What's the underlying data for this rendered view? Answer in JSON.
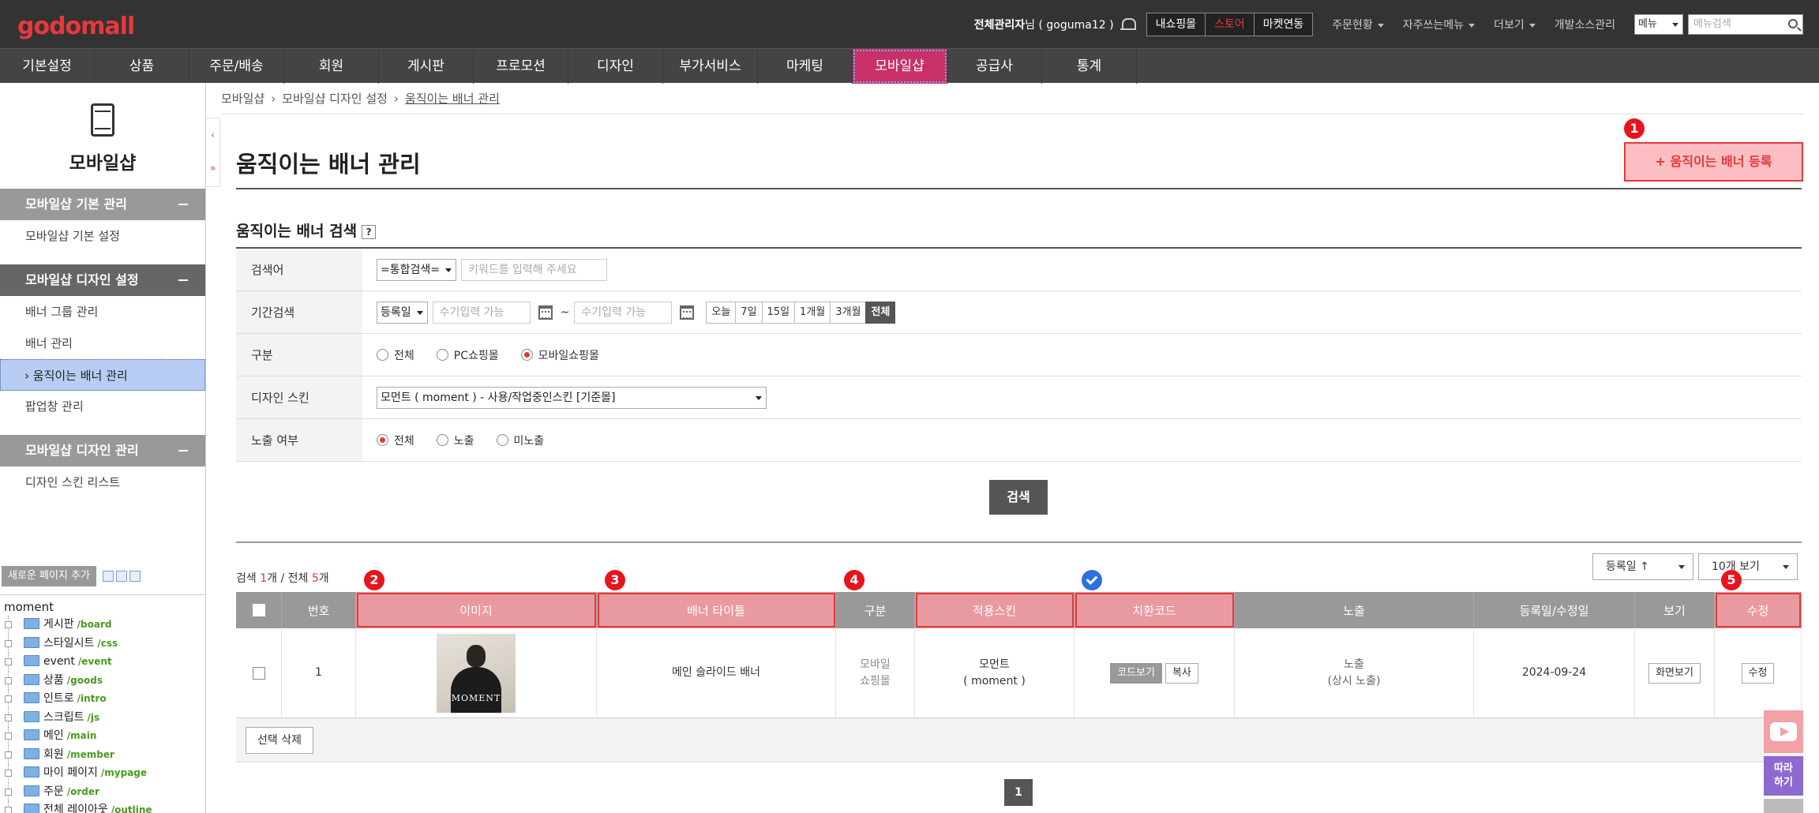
{
  "header": {
    "logo": "godomall",
    "admin_role": "전체관리자",
    "admin_suffix": "님 ( goguma12 )",
    "buttons": [
      "내쇼핑몰",
      "스토어",
      "마켓연동"
    ],
    "links": [
      "주문현황",
      "자주쓰는메뉴",
      "더보기",
      "개발소스관리"
    ],
    "menu_select": "메뉴",
    "menu_search_placeholder": "메뉴검색"
  },
  "gnb": [
    "기본설정",
    "상품",
    "주문/배송",
    "회원",
    "게시판",
    "프로모션",
    "디자인",
    "부가서비스",
    "마케팅",
    "모바일샵",
    "공급사",
    "통계"
  ],
  "lnb": {
    "title": "모바일샵",
    "groups": [
      {
        "title": "모바일샵 기본 관리",
        "items": [
          "모바일샵 기본 설정"
        ]
      },
      {
        "title": "모바일샵 디자인 설정",
        "items": [
          "배너 그룹 관리",
          "배너 관리",
          "움직이는 배너 관리",
          "팝업창 관리"
        ]
      },
      {
        "title": "모바일샵 디자인 관리",
        "items": [
          "디자인 스킨 리스트"
        ]
      }
    ],
    "active_item_prefix": "›",
    "add_page": "새로운 페이지 추가",
    "tree_root": "moment",
    "tree": [
      {
        "name": "게시판",
        "path": "/board"
      },
      {
        "name": "스타일시트",
        "path": "/css"
      },
      {
        "name": "event",
        "path": "/event"
      },
      {
        "name": "상품",
        "path": "/goods"
      },
      {
        "name": "인트로",
        "path": "/intro"
      },
      {
        "name": "스크립트",
        "path": "/js"
      },
      {
        "name": "메인",
        "path": "/main"
      },
      {
        "name": "회원",
        "path": "/member"
      },
      {
        "name": "마이 페이지",
        "path": "/mypage"
      },
      {
        "name": "주문",
        "path": "/order"
      },
      {
        "name": "전체 레이아웃",
        "path": "/outline"
      }
    ]
  },
  "breadcrumb": [
    "모바일샵",
    "모바일샵 디자인 설정",
    "움직이는 배너 관리"
  ],
  "page": {
    "title": "움직이는 배너 관리",
    "register_button": "+ 움직이는 배너 등록",
    "search_section_title": "움직이는 배너 검색",
    "help": "?"
  },
  "search": {
    "keyword_label": "검색어",
    "keyword_select": "=통합검색=",
    "keyword_placeholder": "키워드를 입력해 주세요",
    "period_label": "기간검색",
    "period_select": "등록일",
    "date_placeholder": "수기입력 가능",
    "tilde": "~",
    "period_buttons": [
      "오늘",
      "7일",
      "15일",
      "1개월",
      "3개월",
      "전체"
    ],
    "type_label": "구분",
    "type_options": [
      "전체",
      "PC쇼핑몰",
      "모바일쇼핑몰"
    ],
    "skin_label": "디자인 스킨",
    "skin_select": "모먼트 ( moment ) - 사용/작업중인스킨 [기준몰]",
    "expose_label": "노출 여부",
    "expose_options": [
      "전체",
      "노출",
      "미노출"
    ],
    "search_button": "검색"
  },
  "result": {
    "prefix": "검색 ",
    "found": "1",
    "mid": "개 / 전체 ",
    "total": "5",
    "suffix": "개",
    "sort_select": "등록일 ↑",
    "page_size_select": "10개 보기"
  },
  "table": {
    "headers": [
      "번호",
      "이미지",
      "배너 타이틀",
      "구분",
      "적용스킨",
      "치환코드",
      "노출",
      "등록일/수정일",
      "보기",
      "수정"
    ],
    "rows": [
      {
        "no": "1",
        "thumb_text": "MOMENT",
        "title": "메인 슬라이드 배너",
        "type_line1": "모바일",
        "type_line2": "쇼핑몰",
        "skin_line1": "모먼트",
        "skin_line2": "( moment )",
        "code_view": "코드보기",
        "code_copy": "복사",
        "expose_line1": "노출",
        "expose_line2": "(상시 노출)",
        "date": "2024-09-24",
        "view_button": "화면보기",
        "edit_button": "수정"
      }
    ],
    "delete_button": "선택 삭제",
    "page": "1"
  },
  "annotations": [
    "1",
    "2",
    "3",
    "4",
    "5"
  ],
  "floating": {
    "follow_line1": "따라",
    "follow_line2": "하기"
  }
}
